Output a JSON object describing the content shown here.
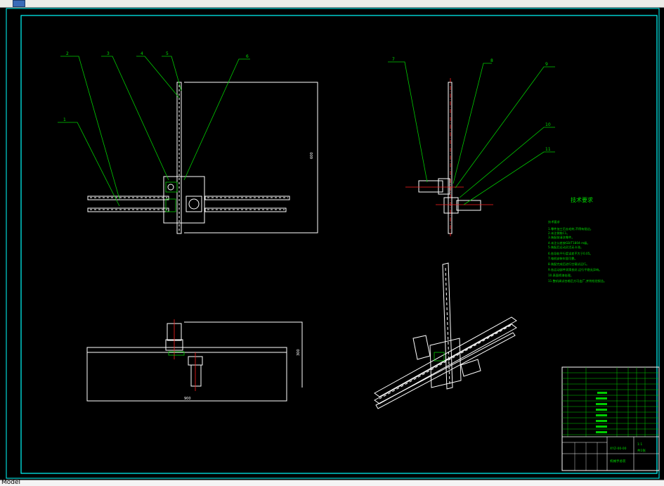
{
  "app": {
    "title_icon": "autocad-document-icon",
    "layout_tab": "Model"
  },
  "drawing": {
    "colors": {
      "background": "#000000",
      "frame": "#00ffff",
      "leader": "#00cc00",
      "geometry": "#ffffff",
      "centerline": "#ff2020"
    },
    "front_view_callouts": [
      "1",
      "2",
      "3",
      "4",
      "5",
      "6"
    ],
    "side_view_callouts": [
      "7",
      "8",
      "9",
      "10",
      "11"
    ],
    "tech_title": "技术要求",
    "tech_lines": [
      "技术要求",
      "1.零件加工后去毛刺,不得有锐边。",
      "2.未注倒角C1。",
      "3.装配前清洗零件。",
      "4.未注公差按GB/T1804-m级。",
      "5.装配后运动灵活无卡滞。",
      "6.各导轨平行度误差不大于0.05。",
      "7.电机安装牢固可靠。",
      "8.装配完成后进行空载试运行。",
      "9.各运动部件润滑良好,运行平稳无异响。",
      "10.表面喷漆处理。",
      "11.整机调试合格后方可出厂,并附检验报告。"
    ],
    "title_block": {
      "drawing_no": "XYZ-00-00",
      "name": "机械手总装",
      "scale": "1:1",
      "sheet": "共1张"
    }
  }
}
